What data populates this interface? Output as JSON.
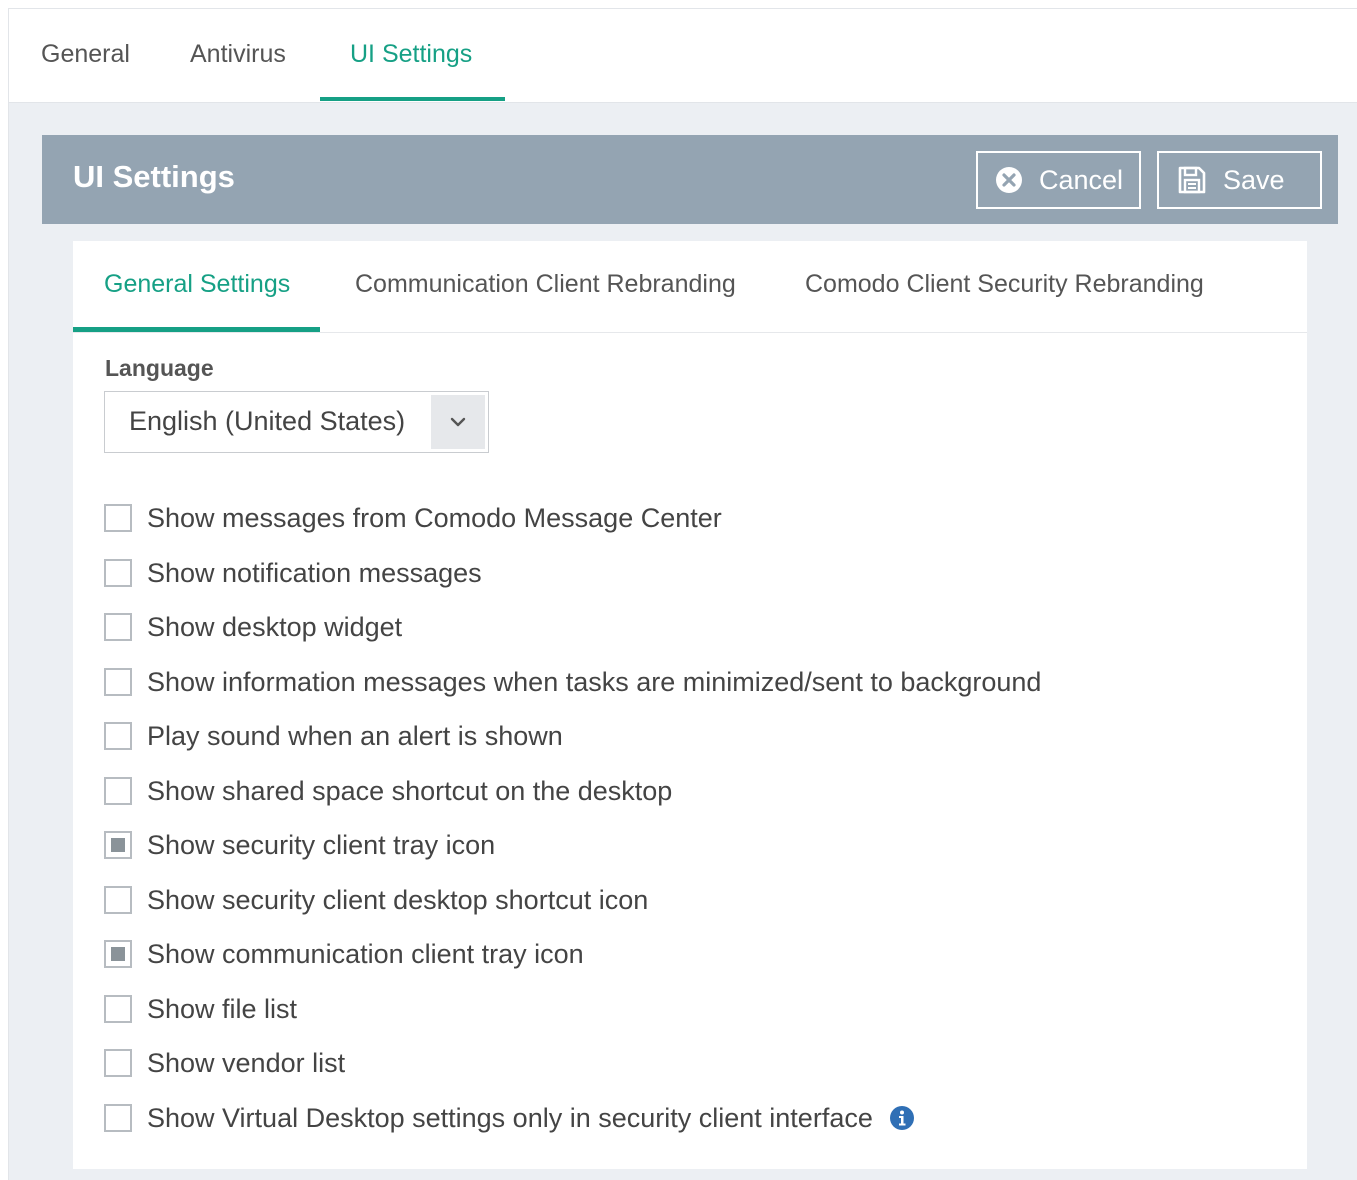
{
  "top_tabs": [
    {
      "label": "General",
      "active": false
    },
    {
      "label": "Antivirus",
      "active": false
    },
    {
      "label": "UI Settings",
      "active": true
    }
  ],
  "panel": {
    "title": "UI Settings",
    "cancel_label": "Cancel",
    "save_label": "Save",
    "cancel_icon": "close-circle-icon",
    "save_icon": "floppy-disk-icon"
  },
  "sub_tabs": [
    {
      "label": "General Settings",
      "active": true
    },
    {
      "label": "Communication Client Rebranding",
      "active": false
    },
    {
      "label": "Comodo Client Security Rebranding",
      "active": false
    }
  ],
  "language": {
    "label": "Language",
    "selected": "English (United States)"
  },
  "options": [
    {
      "label": "Show messages from Comodo Message Center",
      "checked": false
    },
    {
      "label": "Show notification messages",
      "checked": false
    },
    {
      "label": "Show desktop widget",
      "checked": false
    },
    {
      "label": "Show information messages when tasks are minimized/sent to background",
      "checked": false
    },
    {
      "label": "Play sound when an alert is shown",
      "checked": false
    },
    {
      "label": "Show shared space shortcut on the desktop",
      "checked": false
    },
    {
      "label": "Show security client tray icon",
      "checked": true
    },
    {
      "label": "Show security client desktop shortcut icon",
      "checked": false
    },
    {
      "label": "Show communication client tray icon",
      "checked": true
    },
    {
      "label": "Show file list",
      "checked": false
    },
    {
      "label": "Show vendor list",
      "checked": false
    },
    {
      "label": "Show Virtual Desktop settings only in security client interface",
      "checked": false
    }
  ],
  "colors": {
    "accent": "#16a085",
    "header_bg": "#94a4b2",
    "info_icon": "#2f6fb5"
  }
}
